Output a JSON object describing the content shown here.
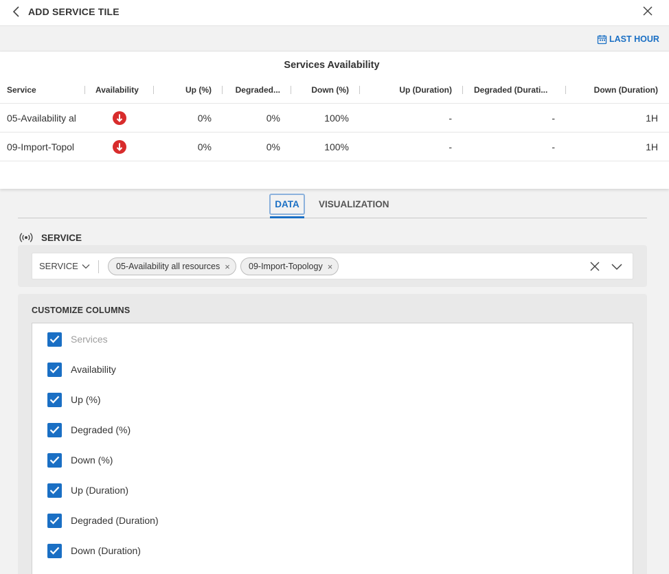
{
  "header": {
    "title": "ADD SERVICE TILE"
  },
  "timebar": {
    "label": "LAST HOUR"
  },
  "preview": {
    "title": "Services Availability",
    "columns": [
      "Service",
      "Availability",
      "Up (%)",
      "Degraded...",
      "Down (%)",
      "Up (Duration)",
      "Degraded (Durati...",
      "Down (Duration)"
    ],
    "rows": [
      {
        "service": "05-Availability al",
        "up_pct": "0%",
        "degraded_pct": "0%",
        "down_pct": "100%",
        "up_dur": "-",
        "degraded_dur": "-",
        "down_dur": "1H"
      },
      {
        "service": "09-Import-Topol",
        "up_pct": "0%",
        "degraded_pct": "0%",
        "down_pct": "100%",
        "up_dur": "-",
        "degraded_dur": "-",
        "down_dur": "1H"
      }
    ]
  },
  "tabs": {
    "data": "DATA",
    "visualization": "VISUALIZATION"
  },
  "service": {
    "label": "SERVICE",
    "dropdown_label": "SERVICE",
    "chips": [
      "05-Availability all resources",
      "09-Import-Topology"
    ]
  },
  "customize": {
    "title": "CUSTOMIZE COLUMNS",
    "columns": [
      "Services",
      "Availability",
      "Up (%)",
      "Degraded (%)",
      "Down (%)",
      "Up (Duration)",
      "Degraded (Duration)",
      "Down (Duration)"
    ]
  },
  "colors": {
    "accent": "#1a6fc4",
    "danger": "#d82c2c"
  }
}
